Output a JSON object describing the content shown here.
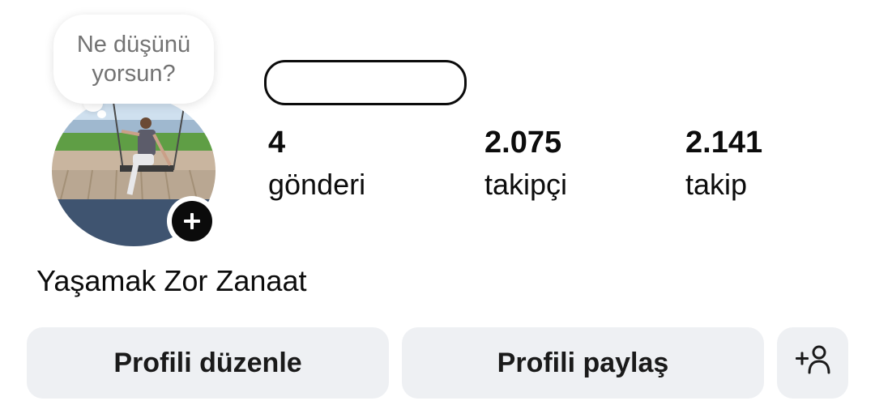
{
  "note": {
    "text": "Ne düşünü yorsun?"
  },
  "profile": {
    "display_name": "Yaşamak Zor Zanaat",
    "add_story_icon": "plus-icon"
  },
  "stats": {
    "posts": {
      "value": "4",
      "label": "gönderi"
    },
    "followers": {
      "value": "2.075",
      "label": "takipçi"
    },
    "following": {
      "value": "2.141",
      "label": "takip"
    }
  },
  "buttons": {
    "edit_profile": "Profili düzenle",
    "share_profile": "Profili paylaş",
    "discover_people_icon": "add-person-icon"
  },
  "colors": {
    "button_bg": "#eef0f3",
    "text": "#0c0c0c",
    "note_text": "#737373"
  }
}
